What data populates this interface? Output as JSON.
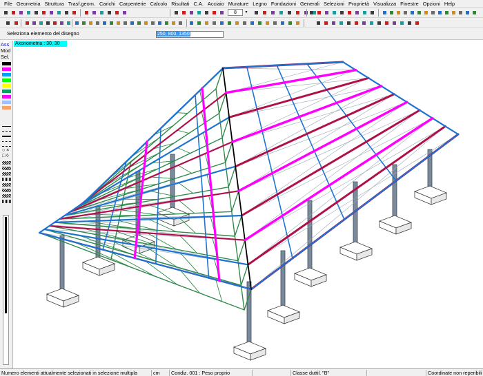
{
  "menubar": {
    "items": [
      "File",
      "Geometria",
      "Struttura",
      "Trasf.geom.",
      "Carichi",
      "Carpenterie",
      "Calcolo",
      "Risultati",
      "C.A.",
      "Acciaio",
      "Murature",
      "Legno",
      "Fondazioni",
      "Generali",
      "Selezioni",
      "Proprietà",
      "Visualizza",
      "Finestre",
      "Opzioni",
      "Help"
    ]
  },
  "toolbar1": {
    "counter_value": "8",
    "counter_dropdown_icon": "chevron-down-icon"
  },
  "command_line": {
    "prompt": "Seleziona  elemento del disegno",
    "input_value": "250, 800, 1350"
  },
  "view": {
    "label": "Axonometria :   30, 30"
  },
  "left_panel": {
    "modes": [
      "Ass",
      "Mod",
      "Sel."
    ],
    "colors": [
      "#000000",
      "#ff00ff",
      "#00a0ff",
      "#00ff00",
      "#ffff00",
      "#00a060",
      "#ff00ff",
      "#a0c0ff",
      "#ffa060"
    ]
  },
  "structure_colors": {
    "roof_purlins": "#1e73d0",
    "trusses": "#2f8a4a",
    "rafters": "#ff00ff",
    "main_beams": "#b0104a",
    "bracing": "#9aa8b8",
    "columns": "#7a8a9a",
    "ridge_beam": "#000000"
  },
  "statusbar": {
    "message": "Numero elementi attualmente selezionati in selezione multipla",
    "units": "cm",
    "load_condition": "Condiz. 001 : Peso proprio",
    "class": "Classe duttil. \"B\"",
    "coordinates": "Coordinate non reperibili"
  }
}
